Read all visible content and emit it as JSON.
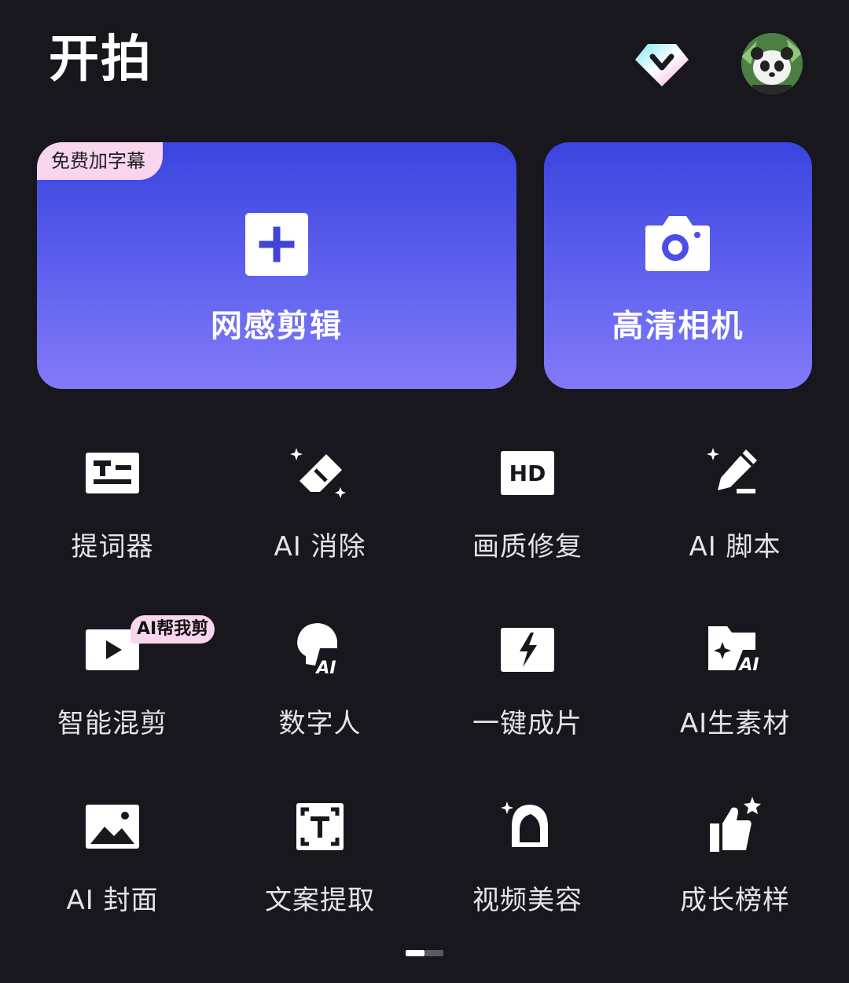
{
  "header": {
    "title": "开拍",
    "vip_icon": "diamond-vip-icon",
    "avatar_icon": "panda-avatar"
  },
  "primary_cards": [
    {
      "label": "网感剪辑",
      "badge": "免费加字幕",
      "icon": "plus-icon"
    },
    {
      "label": "高清相机",
      "icon": "camera-icon"
    }
  ],
  "tools": [
    {
      "label": "提词器",
      "icon": "teleprompter-icon"
    },
    {
      "label": "AI 消除",
      "icon": "eraser-icon"
    },
    {
      "label": "画质修复",
      "icon": "hd-icon"
    },
    {
      "label": "AI 脚本",
      "icon": "pen-sparkle-icon"
    },
    {
      "label": "智能混剪",
      "icon": "play-icon",
      "badge": "AI帮我剪"
    },
    {
      "label": "数字人",
      "icon": "ai-head-icon"
    },
    {
      "label": "一键成片",
      "icon": "lightning-icon"
    },
    {
      "label": "AI生素材",
      "icon": "ai-folder-icon"
    },
    {
      "label": "AI 封面",
      "icon": "image-icon"
    },
    {
      "label": "文案提取",
      "icon": "text-scan-icon"
    },
    {
      "label": "视频美容",
      "icon": "face-beauty-icon"
    },
    {
      "label": "成长榜样",
      "icon": "thumbs-up-star-icon"
    }
  ],
  "pager": {
    "pages": 2,
    "current": 1
  },
  "colors": {
    "background": "#17171d",
    "card_gradient_top": "#3a44df",
    "card_gradient_bottom": "#8479f7",
    "badge_bg": "#f9d5ee"
  }
}
